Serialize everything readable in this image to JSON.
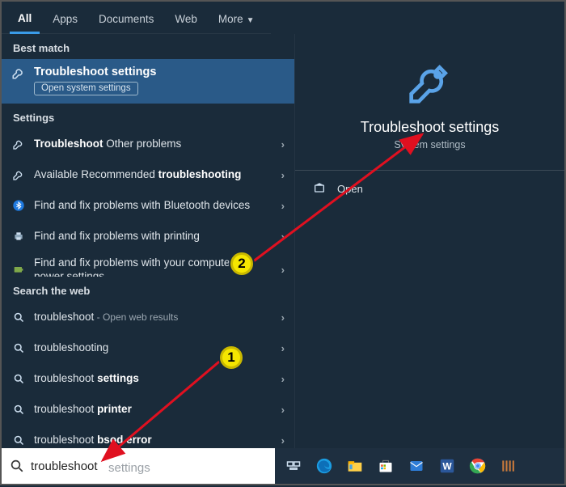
{
  "tabs": {
    "all": "All",
    "apps": "Apps",
    "documents": "Documents",
    "web": "Web",
    "more": "More"
  },
  "sections": {
    "best": "Best match",
    "settings": "Settings",
    "web": "Search the web"
  },
  "best_match": {
    "title": "Troubleshoot settings",
    "badge": "Open system settings"
  },
  "settings_results": [
    {
      "label_pre": "Troubleshoot",
      "label_post": " Other problems",
      "icon": "wrench"
    },
    {
      "label_pre": "Available Recommended ",
      "label_bold": "troubleshooting",
      "icon": "wrench"
    },
    {
      "label": "Find and fix problems with Bluetooth devices",
      "icon": "bluetooth"
    },
    {
      "label": "Find and fix problems with printing",
      "icon": "printer"
    },
    {
      "label": "Find and fix problems with your computer's power settings",
      "icon": "power"
    }
  ],
  "web_results": [
    {
      "label": "troubleshoot",
      "sub": " - Open web results"
    },
    {
      "label": "troubleshooting"
    },
    {
      "label_pre": "troubleshoot ",
      "label_bold": "settings"
    },
    {
      "label_pre": "troubleshoot ",
      "label_bold": "printer"
    },
    {
      "label_pre": "troubleshoot ",
      "label_bold": "bsod error"
    }
  ],
  "detail": {
    "title": "Troubleshoot settings",
    "subtitle": "System settings",
    "open": "Open"
  },
  "search": {
    "value": "troubleshoot",
    "ghost": "settings"
  },
  "annotations": {
    "one": "1",
    "two": "2"
  }
}
